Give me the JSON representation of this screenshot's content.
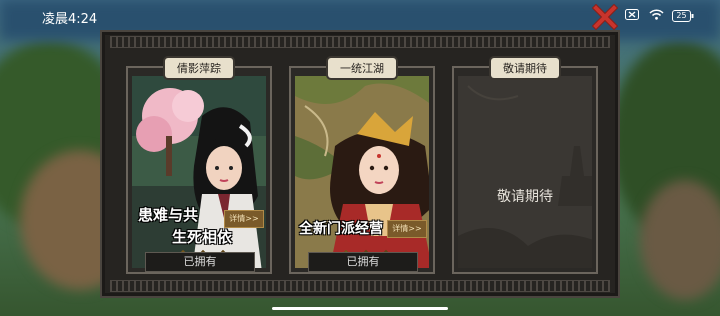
{
  "status": {
    "time": "凌晨4:24",
    "battery": "25"
  },
  "cards": [
    {
      "tag": "倩影萍踪",
      "slogan_line1": "患难与共",
      "slogan_line2": "生死相依",
      "detail_label": "详情>>",
      "owned_label": "已拥有"
    },
    {
      "tag": "一统江湖",
      "slogan_line1": "全新门派经营",
      "detail_label": "详情>>",
      "owned_label": "已拥有"
    },
    {
      "tag": "敬请期待",
      "center_text": "敬请期待"
    }
  ],
  "colors": {
    "accent": "#d9a53a",
    "panel": "#262421",
    "close": "#c8342c"
  },
  "icons": [
    "close-icon",
    "battery-x-icon",
    "wifi-icon",
    "battery-icon"
  ]
}
